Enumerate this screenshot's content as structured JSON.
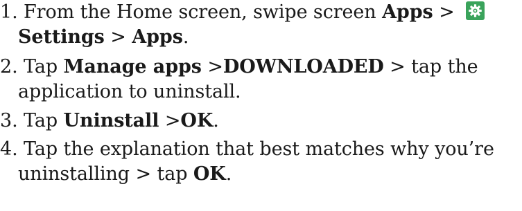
{
  "steps": [
    {
      "number": "1.",
      "parts": {
        "a": "From the Home screen, swipe screen",
        "b_apps": "Apps",
        "sep1": ">",
        "b_settings": "Settings",
        "sep2": ">",
        "b_apps2": "Apps",
        "end": "."
      },
      "icon": "settings-gear-icon",
      "icon_color": "#3aa35b"
    },
    {
      "number": "2.",
      "parts": {
        "a": "Tap",
        "b_manage": "Manage apps",
        "sep1": ">",
        "b_downloaded": "DOWNLOADED",
        "sep2": "> tap the",
        "line2": "application to uninstall."
      }
    },
    {
      "number": "3.",
      "parts": {
        "a": "Tap",
        "b_uninstall": "Uninstall",
        "sep1": ">",
        "b_ok": "OK",
        "end": "."
      }
    },
    {
      "number": "4.",
      "parts": {
        "line1": "Tap the explanation that best matches why you’re",
        "line2a": "uninstalling > tap",
        "b_ok": "OK",
        "end": "."
      }
    }
  ]
}
